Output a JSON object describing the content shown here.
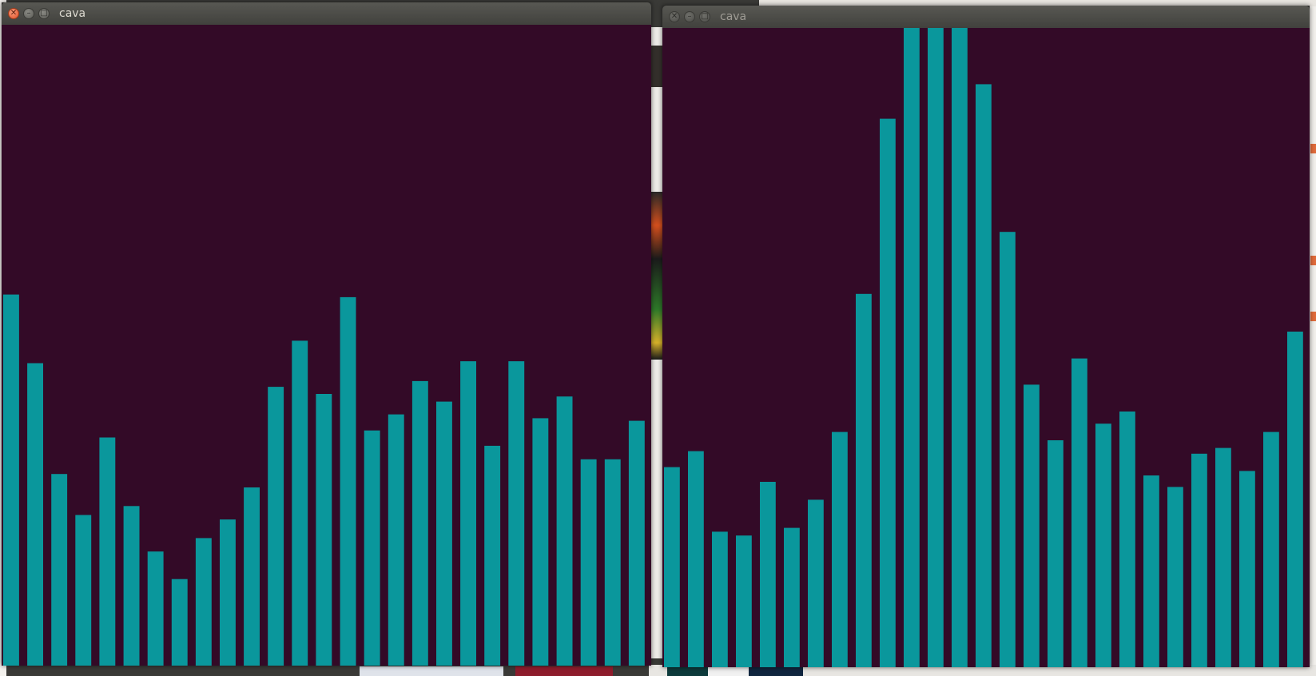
{
  "windows": [
    {
      "title": "cava",
      "active": true,
      "bar_levels": [
        0.579,
        0.472,
        0.299,
        0.235,
        0.356,
        0.249,
        0.178,
        0.135,
        0.199,
        0.228,
        0.278,
        0.435,
        0.507,
        0.424,
        0.575,
        0.367,
        0.392,
        0.444,
        0.412,
        0.475,
        0.343,
        0.475,
        0.386,
        0.42,
        0.322,
        0.322,
        0.382
      ]
    },
    {
      "title": "cava",
      "active": false,
      "bar_levels": [
        0.313,
        0.338,
        0.212,
        0.206,
        0.29,
        0.218,
        0.262,
        0.368,
        0.584,
        0.858,
        1.0,
        1.0,
        1.0,
        0.912,
        0.681,
        0.442,
        0.355,
        0.483,
        0.381,
        0.4,
        0.3,
        0.282,
        0.334,
        0.343,
        0.307,
        0.368,
        0.525
      ]
    }
  ],
  "colors": {
    "bar": "#0a979c",
    "background": "#330a27",
    "close_button": "#e2522a"
  },
  "icons": {
    "close": "close-icon",
    "minimize": "minimize-icon",
    "maximize": "maximize-icon"
  }
}
